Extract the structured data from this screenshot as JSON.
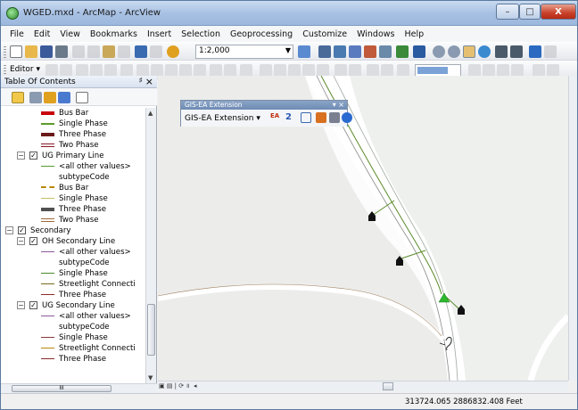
{
  "window": {
    "title": "WGED.mxd - ArcMap - ArcView",
    "min_label": "–",
    "max_label": "□",
    "close_label": "X"
  },
  "menu": [
    "File",
    "Edit",
    "View",
    "Bookmarks",
    "Insert",
    "Selection",
    "Geoprocessing",
    "Customize",
    "Windows",
    "Help"
  ],
  "toolbar": {
    "scale": "1:2,000",
    "editor_label": "Editor ▾"
  },
  "toc": {
    "title": "Table Of Contents",
    "pin": "♯",
    "close": "×",
    "rows": [
      {
        "label": "Bus Bar"
      },
      {
        "label": "Single Phase"
      },
      {
        "label": "Three Phase"
      },
      {
        "label": "Two Phase"
      },
      {
        "label": "UG Primary Line"
      },
      {
        "label": "<all other values>"
      },
      {
        "label": "subtypeCode"
      },
      {
        "label": "Bus Bar"
      },
      {
        "label": "Single Phase"
      },
      {
        "label": "Three Phase"
      },
      {
        "label": "Two Phase"
      },
      {
        "label": "Secondary"
      },
      {
        "label": "OH Secondary Line"
      },
      {
        "label": "<all other values>"
      },
      {
        "label": "subtypeCode"
      },
      {
        "label": "Single Phase"
      },
      {
        "label": "Streetlight Connecti"
      },
      {
        "label": "Three Phase"
      },
      {
        "label": "UG Secondary Line"
      },
      {
        "label": "<all other values>"
      },
      {
        "label": "subtypeCode"
      },
      {
        "label": "Single Phase"
      },
      {
        "label": "Streetlight Connecti"
      },
      {
        "label": "Three Phase"
      }
    ],
    "expand_minus": "−",
    "check": "✓",
    "hscroll_grip": "III"
  },
  "gisea": {
    "title": "GIS-EA Extension",
    "menu_label": "GIS-EA Extension ▾",
    "ctrls": "▾ ×",
    "ea_label": "EA",
    "two_label": "2"
  },
  "status": {
    "coordinates": "313724.065  2886832.408 Feet"
  },
  "colors": {
    "busbar": "#c8000a",
    "single_phase": "#5a9a2a",
    "three_phase": "#6b1a1a",
    "two_phase": "#8b1a2a",
    "ug_busbar": "#b8860b",
    "ug_single": "#a0b020",
    "ug_three": "#505050",
    "ug_two": "#a06a3a",
    "oh_sec_all": "#8a5a9a",
    "sec_single": "#4a8a2a",
    "streetlight": "#7a6a1a",
    "sec_three": "#8b2a2a"
  }
}
